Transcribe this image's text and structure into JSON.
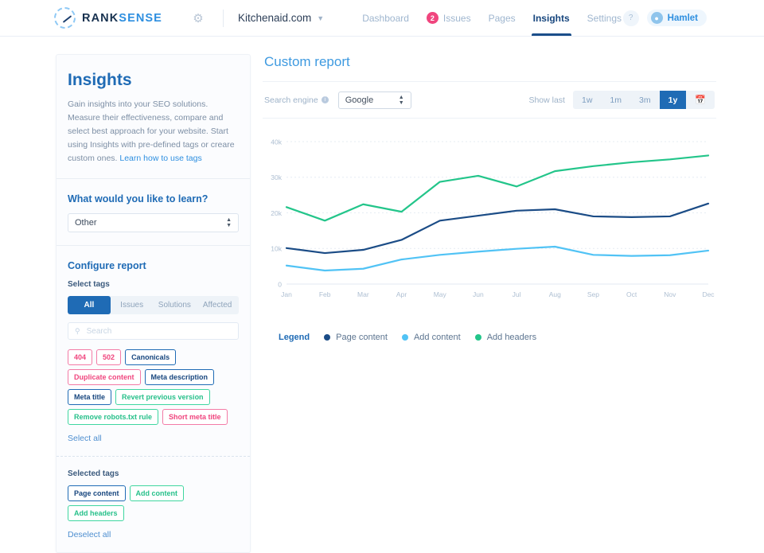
{
  "topbar": {
    "brand_rank": "RANK",
    "brand_sense": "SENSE",
    "gear_icon": "gear-icon",
    "site": "Kitchenaid.com",
    "caret_icon": "chevron-down-icon",
    "nav": [
      {
        "label": "Dashboard",
        "active": false,
        "badge": ""
      },
      {
        "label": "Issues",
        "active": false,
        "badge": "2"
      },
      {
        "label": "Pages",
        "active": false,
        "badge": ""
      },
      {
        "label": "Insights",
        "active": true,
        "badge": ""
      },
      {
        "label": "Settings",
        "active": false,
        "badge": ""
      }
    ],
    "help_icon": "question-mark-icon",
    "avatar_icon": "user-avatar-icon",
    "user": "Hamlet"
  },
  "sidebar": {
    "title": "Insights",
    "description": "Gain insights into your SEO solutions. Measure their effectiveness, compare and select best approach for your website. Start using Insights with pre-defined tags or creare custom ones.",
    "link": "Learn how to use tags",
    "learn_heading": "What would you like to learn?",
    "learn_value": "Other",
    "configure_heading": "Configure report",
    "select_tags_label": "Select tags",
    "tabs": [
      {
        "label": "All",
        "active": true
      },
      {
        "label": "Issues",
        "active": false
      },
      {
        "label": "Solutions",
        "active": false
      },
      {
        "label": "Affected",
        "active": false
      }
    ],
    "search_placeholder": "Search",
    "search_value": "",
    "search_icon": "search-icon",
    "tags": [
      {
        "label": "404",
        "color": "pink"
      },
      {
        "label": "502",
        "color": "pink"
      },
      {
        "label": "Canonicals",
        "color": "blue"
      },
      {
        "label": "Duplicate content",
        "color": "pink"
      },
      {
        "label": "Meta description",
        "color": "blue"
      },
      {
        "label": "Meta title",
        "color": "blue"
      },
      {
        "label": "Revert previous version",
        "color": "green"
      },
      {
        "label": "Remove robots.txt rule",
        "color": "green"
      },
      {
        "label": "Short meta title",
        "color": "pink"
      }
    ],
    "select_all": "Select all",
    "selected_heading": "Selected tags",
    "selected_tags": [
      {
        "label": "Page content",
        "color": "blue"
      },
      {
        "label": "Add content",
        "color": "green"
      },
      {
        "label": "Add headers",
        "color": "green"
      }
    ],
    "deselect_all": "Deselect all"
  },
  "main": {
    "title": "Custom report",
    "search_engine_label": "Search engine",
    "info_icon": "info-icon",
    "engine_value": "Google",
    "show_last_label": "Show last",
    "ranges": [
      {
        "label": "1w",
        "active": false
      },
      {
        "label": "1m",
        "active": false
      },
      {
        "label": "3m",
        "active": false
      },
      {
        "label": "1y",
        "active": true
      }
    ],
    "calendar_icon": "calendar-icon",
    "legend_title": "Legend"
  },
  "chart_data": {
    "type": "line",
    "title": "Custom report",
    "xlabel": "",
    "ylabel": "",
    "grid": true,
    "legend_position": "bottom-left",
    "ylim": [
      0,
      42000
    ],
    "yticks": [
      0,
      10000,
      20000,
      30000,
      40000
    ],
    "ytick_labels": [
      "0",
      "10k",
      "20k",
      "30k",
      "40k"
    ],
    "categories": [
      "Jan",
      "Feb",
      "Mar",
      "Apr",
      "May",
      "Jun",
      "Jul",
      "Aug",
      "Sep",
      "Oct",
      "Nov",
      "Dec"
    ],
    "series": [
      {
        "name": "Page content",
        "color": "#1b4c86",
        "values": [
          10100,
          8700,
          9600,
          12400,
          17800,
          19200,
          20600,
          21000,
          19000,
          18800,
          19000,
          22600
        ]
      },
      {
        "name": "Add content",
        "color": "#51c3f5",
        "values": [
          5200,
          3800,
          4300,
          6900,
          8200,
          9100,
          9900,
          10500,
          8200,
          7900,
          8100,
          9400
        ]
      },
      {
        "name": "Add headers",
        "color": "#23c58a",
        "values": [
          21600,
          17800,
          22400,
          20300,
          28700,
          30400,
          27400,
          31700,
          33100,
          34200,
          35000,
          36100
        ]
      }
    ]
  }
}
